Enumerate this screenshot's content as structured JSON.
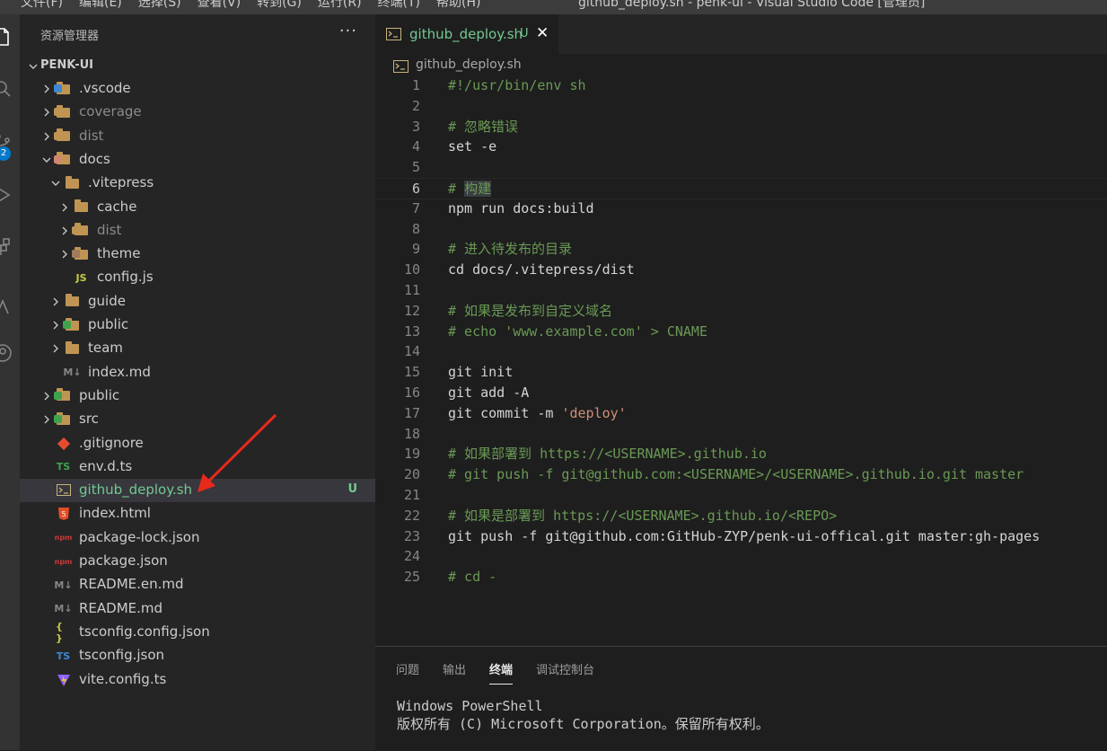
{
  "menubar": {
    "items": [
      "文件(F)",
      "编辑(E)",
      "选择(S)",
      "查看(V)",
      "转到(G)",
      "运行(R)",
      "终端(T)",
      "帮助(H)"
    ],
    "window_title": "github_deploy.sh - penk-ui - Visual Studio Code [管理员]"
  },
  "activity_bar": {
    "scm_badge": "2",
    "icons": [
      "files-icon",
      "search-icon",
      "source-control-icon",
      "run-debug-icon",
      "extensions-icon",
      "remote-icon",
      "account-icon"
    ]
  },
  "sidebar": {
    "title": "资源管理器",
    "more": "···",
    "root": "PENK-UI",
    "items": [
      {
        "label": ".vscode",
        "depth": 1,
        "folder": true,
        "open": false,
        "icon": "vscode-folder-icon",
        "style": ""
      },
      {
        "label": "coverage",
        "depth": 1,
        "folder": true,
        "open": false,
        "icon": "coverage-folder-icon",
        "style": "dim"
      },
      {
        "label": "dist",
        "depth": 1,
        "folder": true,
        "open": false,
        "icon": "dist-folder-icon",
        "style": "dim"
      },
      {
        "label": "docs",
        "depth": 1,
        "folder": true,
        "open": true,
        "icon": "docs-folder-icon",
        "style": ""
      },
      {
        "label": ".vitepress",
        "depth": 2,
        "folder": true,
        "open": true,
        "icon": "folder-open-icon",
        "style": ""
      },
      {
        "label": "cache",
        "depth": 3,
        "folder": true,
        "open": false,
        "icon": "folder-icon",
        "style": ""
      },
      {
        "label": "dist",
        "depth": 3,
        "folder": true,
        "open": false,
        "icon": "dist-folder-icon",
        "style": "dim"
      },
      {
        "label": "theme",
        "depth": 3,
        "folder": true,
        "open": false,
        "icon": "theme-folder-icon",
        "style": ""
      },
      {
        "label": "config.js",
        "depth": 3,
        "folder": false,
        "icon": "js-file-icon",
        "style": ""
      },
      {
        "label": "guide",
        "depth": 2,
        "folder": true,
        "open": false,
        "icon": "folder-icon",
        "style": ""
      },
      {
        "label": "public",
        "depth": 2,
        "folder": true,
        "open": false,
        "icon": "public-folder-icon",
        "style": ""
      },
      {
        "label": "team",
        "depth": 2,
        "folder": true,
        "open": false,
        "icon": "folder-icon",
        "style": ""
      },
      {
        "label": "index.md",
        "depth": 2,
        "folder": false,
        "icon": "markdown-file-icon",
        "style": ""
      },
      {
        "label": "public",
        "depth": 1,
        "folder": true,
        "open": false,
        "icon": "public-folder-icon",
        "style": ""
      },
      {
        "label": "src",
        "depth": 1,
        "folder": true,
        "open": false,
        "icon": "src-folder-icon",
        "style": ""
      },
      {
        "label": ".gitignore",
        "depth": 1,
        "folder": false,
        "icon": "git-file-icon",
        "style": ""
      },
      {
        "label": "env.d.ts",
        "depth": 1,
        "folder": false,
        "icon": "ts-file-icon",
        "style": ""
      },
      {
        "label": "github_deploy.sh",
        "depth": 1,
        "folder": false,
        "icon": "shell-file-icon",
        "style": "git",
        "status": "U",
        "selected": true
      },
      {
        "label": "index.html",
        "depth": 1,
        "folder": false,
        "icon": "html-file-icon",
        "style": ""
      },
      {
        "label": "package-lock.json",
        "depth": 1,
        "folder": false,
        "icon": "npm-file-icon",
        "style": ""
      },
      {
        "label": "package.json",
        "depth": 1,
        "folder": false,
        "icon": "npm-file-icon",
        "style": ""
      },
      {
        "label": "README.en.md",
        "depth": 1,
        "folder": false,
        "icon": "markdown-file-icon",
        "style": ""
      },
      {
        "label": "README.md",
        "depth": 1,
        "folder": false,
        "icon": "markdown-file-icon",
        "style": ""
      },
      {
        "label": "tsconfig.config.json",
        "depth": 1,
        "folder": false,
        "icon": "json-file-icon",
        "style": ""
      },
      {
        "label": "tsconfig.json",
        "depth": 1,
        "folder": false,
        "icon": "tsconfig-file-icon",
        "style": ""
      },
      {
        "label": "vite.config.ts",
        "depth": 1,
        "folder": false,
        "icon": "vite-file-icon",
        "style": ""
      }
    ]
  },
  "editor": {
    "tab": {
      "label": "github_deploy.sh",
      "status": "U",
      "close": "✕"
    },
    "breadcrumb": "github_deploy.sh",
    "current_line": 6,
    "lines": [
      [
        {
          "t": "#!/usr/bin/env sh",
          "c": "com"
        }
      ],
      [],
      [
        {
          "t": "# 忽略错误",
          "c": "com"
        }
      ],
      [
        {
          "t": "set -e",
          "c": ""
        }
      ],
      [],
      [
        {
          "t": "# ",
          "c": "com"
        },
        {
          "t": "构建",
          "c": "com hl"
        }
      ],
      [
        {
          "t": "npm run docs:build",
          "c": ""
        }
      ],
      [],
      [
        {
          "t": "# 进入待发布的目录",
          "c": "com"
        }
      ],
      [
        {
          "t": "cd docs/.vitepress/dist",
          "c": ""
        }
      ],
      [],
      [
        {
          "t": "# 如果是发布到自定义域名",
          "c": "com"
        }
      ],
      [
        {
          "t": "# echo 'www.example.com' > CNAME",
          "c": "com"
        }
      ],
      [],
      [
        {
          "t": "git init",
          "c": ""
        }
      ],
      [
        {
          "t": "git add -A",
          "c": ""
        }
      ],
      [
        {
          "t": "git commit -m ",
          "c": ""
        },
        {
          "t": "'deploy'",
          "c": "str"
        }
      ],
      [],
      [
        {
          "t": "# 如果部署到 https://<USERNAME>.github.io",
          "c": "com"
        }
      ],
      [
        {
          "t": "# git push -f git@github.com:<USERNAME>/<USERNAME>.github.io.git master",
          "c": "com"
        }
      ],
      [],
      [
        {
          "t": "# 如果是部署到 https://<USERNAME>.github.io/<REPO>",
          "c": "com"
        }
      ],
      [
        {
          "t": "git push -f git@github.com:GitHub-ZYP/penk-ui-offical.git master:gh-pages",
          "c": ""
        }
      ],
      [],
      [
        {
          "t": "# cd -",
          "c": "com"
        }
      ]
    ]
  },
  "panel": {
    "tabs": [
      "问题",
      "输出",
      "终端",
      "调试控制台"
    ],
    "active_tab": "终端",
    "terminal_lines": [
      "Windows PowerShell",
      "版权所有 (C) Microsoft Corporation。保留所有权利。"
    ]
  },
  "colors": {
    "accent": "#007acc",
    "untracked": "#73c991",
    "comment": "#6a9955",
    "string": "#ce9178",
    "annotation_arrow": "#e8291c"
  }
}
